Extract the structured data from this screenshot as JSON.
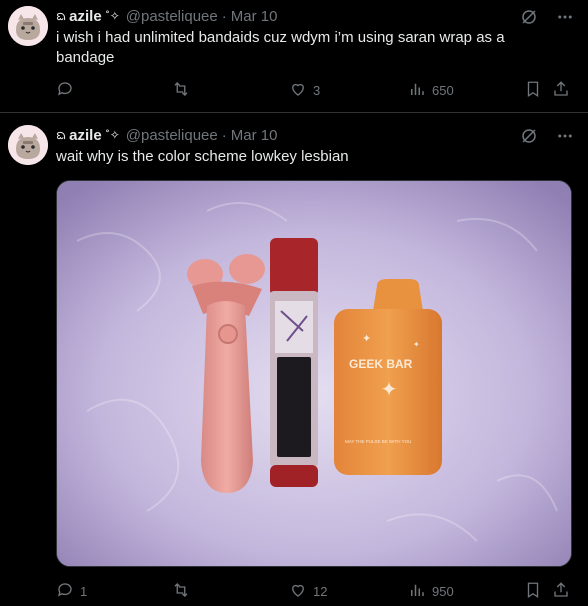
{
  "tweets": [
    {
      "display_name": "azile",
      "handle": "@pasteliquee",
      "separator": "·",
      "date": "Mar 10",
      "text": "i wish i had unlimited bandaids cuz wdym i’m using saran wrap as a bandage",
      "replies": "",
      "retweets": "",
      "likes": "3",
      "views": "650"
    },
    {
      "display_name": "azile",
      "handle": "@pasteliquee",
      "separator": "·",
      "date": "Mar 10",
      "text": "wait why is the color scheme lowkey lesbian",
      "replies": "1",
      "retweets": "",
      "likes": "12",
      "views": "950",
      "image_text": {
        "brand": "GEEK BAR",
        "tagline": "MAY THE PULSE BE WITH YOU"
      }
    }
  ],
  "icons": {
    "grok": "grok-icon",
    "more": "more-icon",
    "reply": "reply-icon",
    "retweet": "retweet-icon",
    "like": "heart-icon",
    "views": "views-icon",
    "bookmark": "bookmark-icon",
    "share": "share-icon",
    "name_decor": "name-decoration-icon"
  },
  "colors": {
    "background": "#000000",
    "text": "#e7e9ea",
    "muted": "#71767b",
    "divider": "#2f3336"
  }
}
